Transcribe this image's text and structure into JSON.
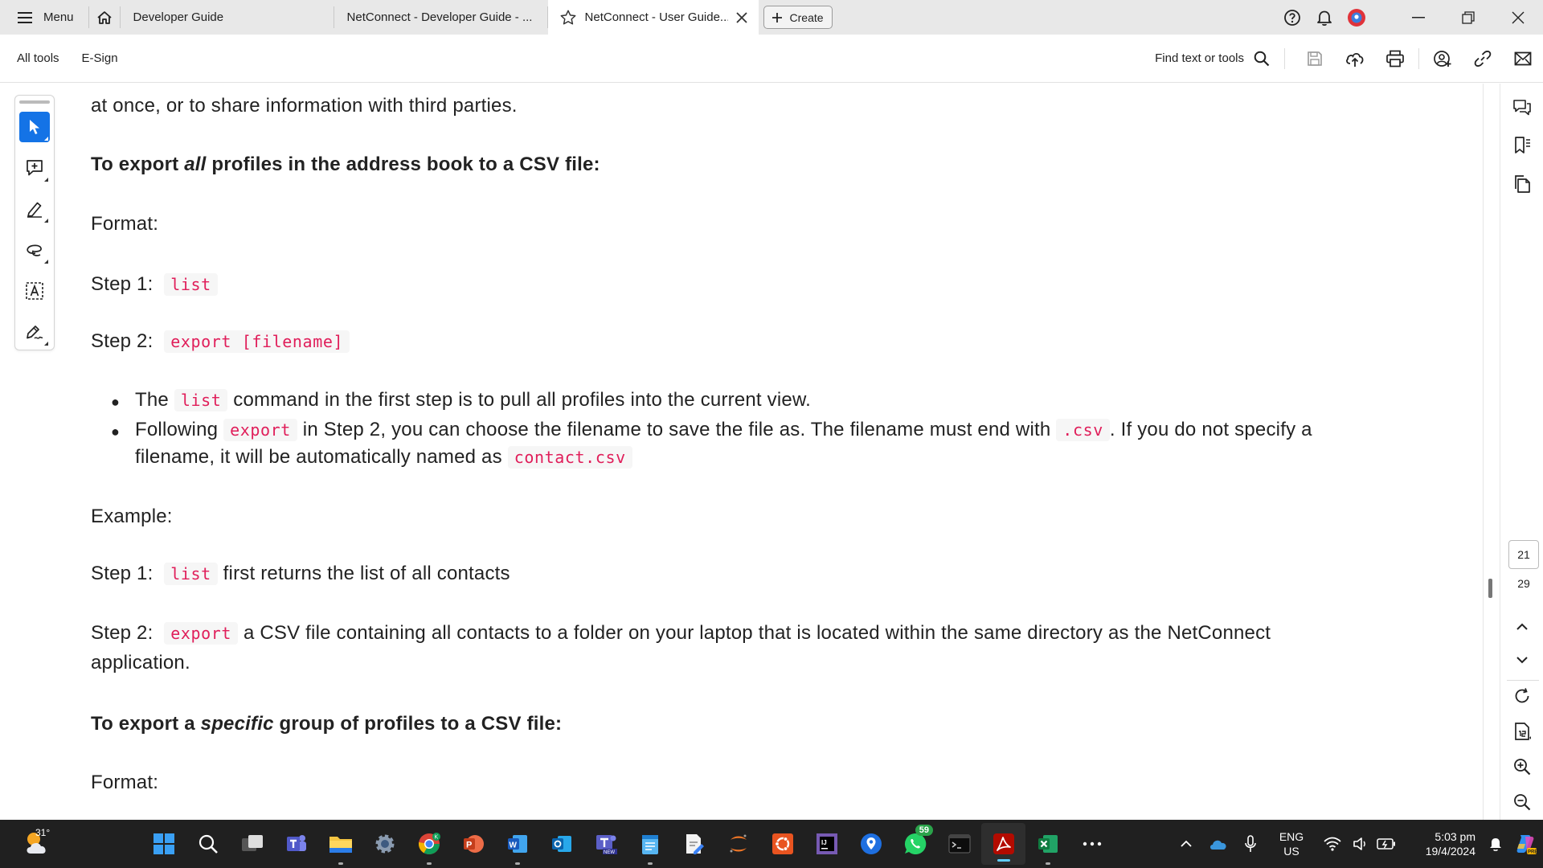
{
  "window": {
    "menu_label": "Menu",
    "tabs": [
      {
        "title": "Developer Guide"
      },
      {
        "title": "NetConnect - Developer Guide - ..."
      },
      {
        "title": "NetConnect - User Guide..."
      }
    ],
    "create_label": "Create"
  },
  "toolbar": {
    "all_tools": "All tools",
    "esign": "E-Sign",
    "find_label": "Find text or tools"
  },
  "document": {
    "cut_top_line": "at once, or to share information with third parties.",
    "heading1": {
      "pre": "To export ",
      "em": "all",
      "post": " profiles in the address book to a CSV file:"
    },
    "format1": "Format:",
    "step1_label": "Step 1:",
    "step1_code": "list",
    "step2_label": "Step 2:",
    "step2_code": "export [filename]",
    "bullet1": {
      "pre": "The",
      "code": "list",
      "post": "command in the first step is to pull all profiles into the current view."
    },
    "bullet2": {
      "pre": "Following",
      "code1": "export",
      "mid": "in Step 2, you can choose the filename to save the file as. The filename must end with",
      "code2": ".csv",
      "post": ". If you do not specify a",
      "line2": "filename, it will be automatically named as",
      "code3": "contact.csv"
    },
    "example": "Example:",
    "ex_step1_label": "Step 1:",
    "ex_step1_code": "list",
    "ex_step1_text": "first returns the list of all contacts",
    "ex_step2_label": "Step 2:",
    "ex_step2_code": "export",
    "ex_step2_text": "a CSV file containing all contacts to a folder on your laptop that is located within the same directory as the NetConnect",
    "ex_step2_line2": "application.",
    "heading2": {
      "pre": "To export a ",
      "em": "specific",
      "post": " group of profiles to a CSV file:"
    },
    "format2": "Format:"
  },
  "pagination": {
    "current": "21",
    "total": "29"
  },
  "taskbar": {
    "temperature": "31°",
    "whatsapp_badge": "59",
    "lang_line1": "ENG",
    "lang_line2": "US",
    "time": "5:03 pm",
    "date": "19/4/2024"
  }
}
